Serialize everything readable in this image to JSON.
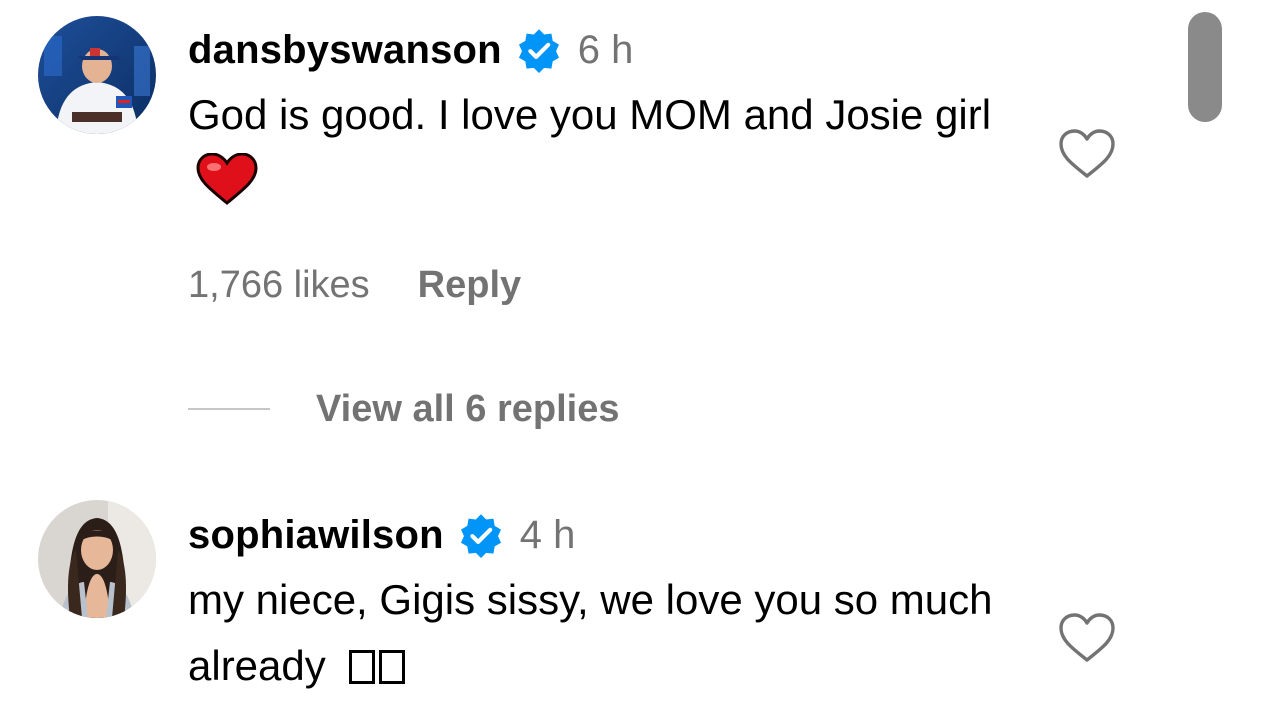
{
  "comments": [
    {
      "username": "dansbyswanson",
      "verified": true,
      "time": "6 h",
      "text": "God is good. I love you MOM and Josie girl",
      "emoji_icon": "red-heart-emoji",
      "likes": "1,766 likes",
      "reply_label": "Reply",
      "avatar_icon": "baseball-player-avatar"
    },
    {
      "username": "sophiawilson",
      "verified": true,
      "time": "4 h",
      "text": "my niece, Gigis sissy, we love you so much already",
      "emoji_icon": "missing-glyph-boxes",
      "avatar_icon": "woman-avatar"
    }
  ],
  "view_replies_label": "View all 6 replies",
  "colors": {
    "verified_blue": "#0095f6",
    "secondary_text": "#737373",
    "heart_red": "#e0101a"
  }
}
